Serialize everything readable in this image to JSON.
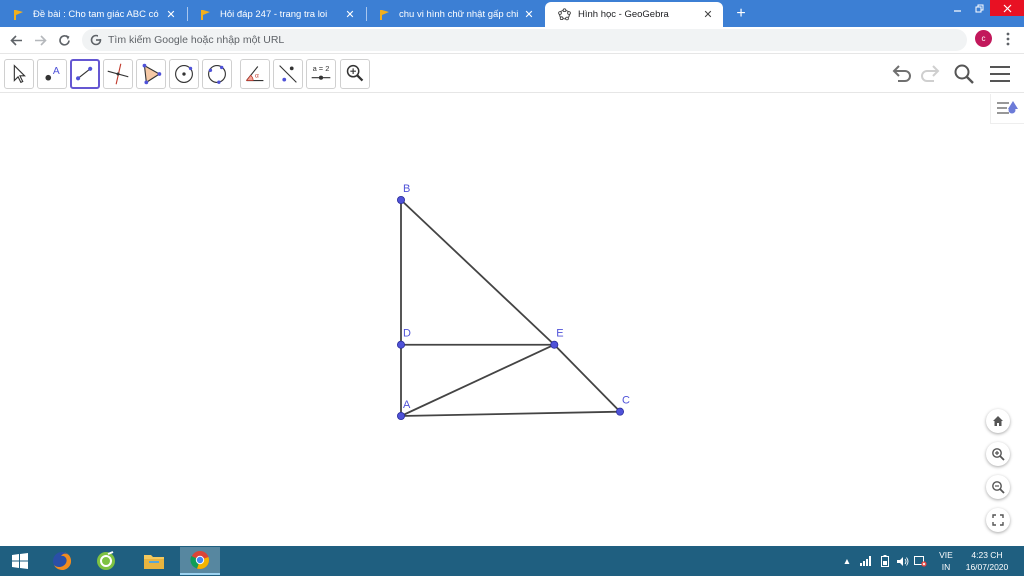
{
  "browser": {
    "tabs": [
      {
        "title": "Đề bài : Cho tam giác ABC có góc",
        "active": false
      },
      {
        "title": "Hỏi đáp 247 - trang tra loi",
        "active": false
      },
      {
        "title": "chu vi hình chữ nhật gấp chiều rộng",
        "active": false
      },
      {
        "title": "Hình học - GeoGebra",
        "active": true
      }
    ],
    "new_tab_label": "+",
    "omnibox_placeholder": "Tìm kiếm Google hoặc nhập một URL",
    "profile_initial": "c",
    "profile_color": "#c2185b",
    "tabstrip_color": "#3c7fd4"
  },
  "geogebra": {
    "tools": [
      {
        "name": "move-tool",
        "icon": "arrow-cursor-icon"
      },
      {
        "name": "point-tool",
        "icon": "point-icon"
      },
      {
        "name": "segment-tool",
        "icon": "segment-icon",
        "selected": true
      },
      {
        "name": "perpendicular-line-tool",
        "icon": "perpendicular-icon"
      },
      {
        "name": "polygon-tool",
        "icon": "polygon-icon"
      },
      {
        "name": "circle-center-point-tool",
        "icon": "circle-center-icon"
      },
      {
        "name": "circle-three-points-tool",
        "icon": "circle-three-points-icon"
      },
      {
        "name": "angle-tool",
        "icon": "angle-icon"
      },
      {
        "name": "reflect-tool",
        "icon": "reflect-icon"
      },
      {
        "name": "slider-tool",
        "icon": "slider-icon",
        "label": "a = 2"
      },
      {
        "name": "zoom-in-tool",
        "icon": "zoom-tool-icon"
      }
    ],
    "points": [
      {
        "label": "B",
        "x": 0,
        "y": 10
      },
      {
        "label": "D",
        "x": 0,
        "y": 3.3
      },
      {
        "label": "E",
        "x": 7,
        "y": 3.3
      },
      {
        "label": "A",
        "x": 0,
        "y": 0
      },
      {
        "label": "C",
        "x": 10,
        "y": 0.2
      }
    ],
    "segments": [
      [
        "B",
        "D"
      ],
      [
        "D",
        "A"
      ],
      [
        "B",
        "E"
      ],
      [
        "E",
        "C"
      ],
      [
        "A",
        "C"
      ],
      [
        "D",
        "E"
      ],
      [
        "A",
        "E"
      ]
    ],
    "point_color": "#4f52d8",
    "label_color": "#4f52d8",
    "segment_color": "#444444",
    "selected_tool_color": "#6557d2"
  },
  "taskbar": {
    "language": [
      "VIE",
      "IN"
    ],
    "time": "4:23 CH",
    "date": "16/07/2020",
    "tray_arrow": "▲",
    "color": "#1f5f80"
  }
}
